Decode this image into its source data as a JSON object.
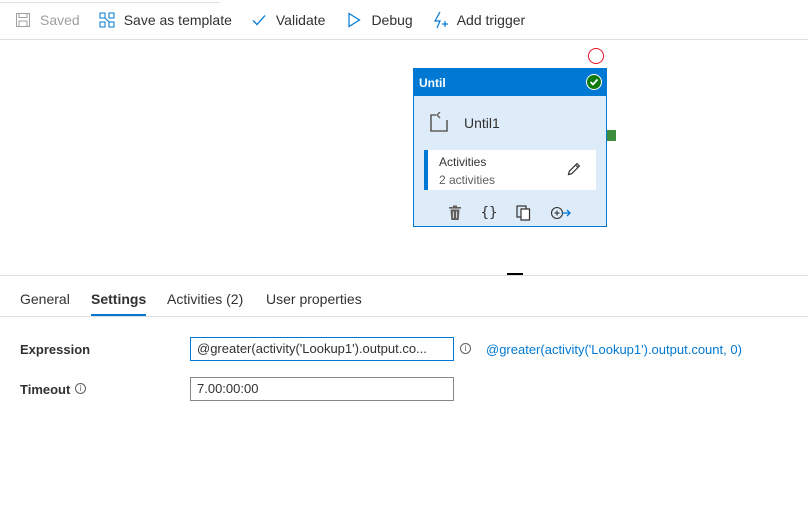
{
  "toolbar": {
    "saved": "Saved",
    "save_as_template": "Save as template",
    "validate": "Validate",
    "debug": "Debug",
    "add_trigger": "Add trigger"
  },
  "node": {
    "type_label": "Until",
    "name": "Until1",
    "activities_title": "Activities",
    "activities_count": "2 activities",
    "action_icons": [
      "delete-icon",
      "code-icon",
      "copy-icon",
      "add-output-icon"
    ]
  },
  "tabs": [
    {
      "label": "General"
    },
    {
      "label": "Settings",
      "active": true
    },
    {
      "label": "Activities (2)"
    },
    {
      "label": "User properties"
    }
  ],
  "settings": {
    "expression_label": "Expression",
    "expression_value": "@greater(activity('Lookup1').output.co...",
    "expression_full": "@greater(activity('Lookup1').output.count, 0)",
    "timeout_label": "Timeout",
    "timeout_value": "7.00:00:00"
  },
  "colors": {
    "accent": "#0078d4",
    "node_fill": "#deecf9",
    "success": "#107c10",
    "error": "#e81123",
    "port": "#3c8d3c"
  }
}
